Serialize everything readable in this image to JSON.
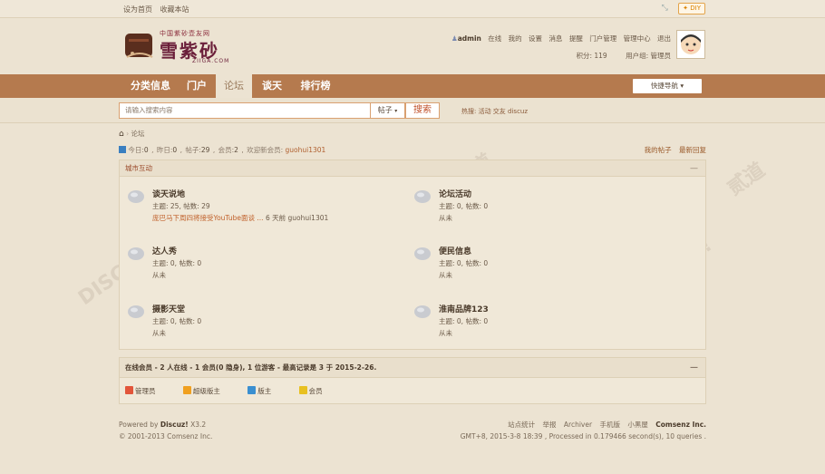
{
  "topbar": {
    "set_home": "设为首页",
    "favorite": "收藏本站",
    "diy": "DIY"
  },
  "logo": {
    "small": "中国紫砂壶友网",
    "big": "雪紫砂",
    "en": "ZIIGA.COM"
  },
  "user": {
    "name": "admin",
    "status": "在线",
    "mine": "我的",
    "settings": "设置",
    "messages": "消息",
    "remind": "提醒",
    "portal_manage": "门户管理",
    "admin_center": "管理中心",
    "logout": "退出",
    "points": "积分: 119",
    "group": "用户组: 管理员"
  },
  "nav": {
    "items": [
      "分类信息",
      "门户",
      "论坛",
      "谈天",
      "排行榜"
    ],
    "quick": "快捷导航"
  },
  "search": {
    "placeholder": "请输入搜索内容",
    "type": "帖子",
    "button": "搜索",
    "hot": "热搜: 活动 交友 discuz"
  },
  "crumb": {
    "home": "论坛"
  },
  "stats": {
    "today_label": "今日:",
    "today": "0",
    "yesterday_label": "昨日:",
    "yesterday": "0",
    "posts_label": "帖子:",
    "posts": "29",
    "members_label": "会员:",
    "members": "2",
    "welcome_label": "欢迎新会员:",
    "newest": "guohui1301",
    "my_posts": "我的帖子",
    "latest_reply": "最新回复"
  },
  "section": {
    "title": "城市互动",
    "collapse": "—",
    "forums": [
      {
        "name": "谈天说地",
        "meta": "主题: 25, 帖数: 29",
        "last_title": "庞巴马下周四将接受YouTube面谈 ...",
        "last_time": "6 天前",
        "last_user": "guohui1301"
      },
      {
        "name": "论坛活动",
        "meta": "主题: 0, 帖数: 0",
        "last": "从未"
      },
      {
        "name": "达人秀",
        "meta": "主题: 0, 帖数: 0",
        "last": "从未"
      },
      {
        "name": "便民信息",
        "meta": "主题: 0, 帖数: 0",
        "last": "从未"
      },
      {
        "name": "摄影天堂",
        "meta": "主题: 0, 帖数: 0",
        "last": "从未"
      },
      {
        "name": "淮南品牌123",
        "meta": "主题: 0, 帖数: 0",
        "last": "从未"
      }
    ]
  },
  "online": {
    "title": "在线会员 - 2 人在线 - 1 会员(0 隐身), 1 位游客 - 最高记录是 3 于 2015-2-26.",
    "collapse": "—",
    "legend": [
      {
        "label": "管理员",
        "color": "#e2553a"
      },
      {
        "label": "超级版主",
        "color": "#f0a020"
      },
      {
        "label": "版主",
        "color": "#3a8fd0"
      },
      {
        "label": "会员",
        "color": "#e8c020"
      }
    ]
  },
  "footer": {
    "powered": "Powered by",
    "brand": "Discuz!",
    "version": "X3.2",
    "copyright": "© 2001-2013 Comsenz Inc.",
    "links": [
      "站点统计",
      "举报",
      "Archiver",
      "手机版",
      "小黑屋"
    ],
    "company": "Comsenz Inc.",
    "runtime": "GMT+8, 2015-3-8 18:39 , Processed in 0.179466 second(s), 10 queries ."
  }
}
